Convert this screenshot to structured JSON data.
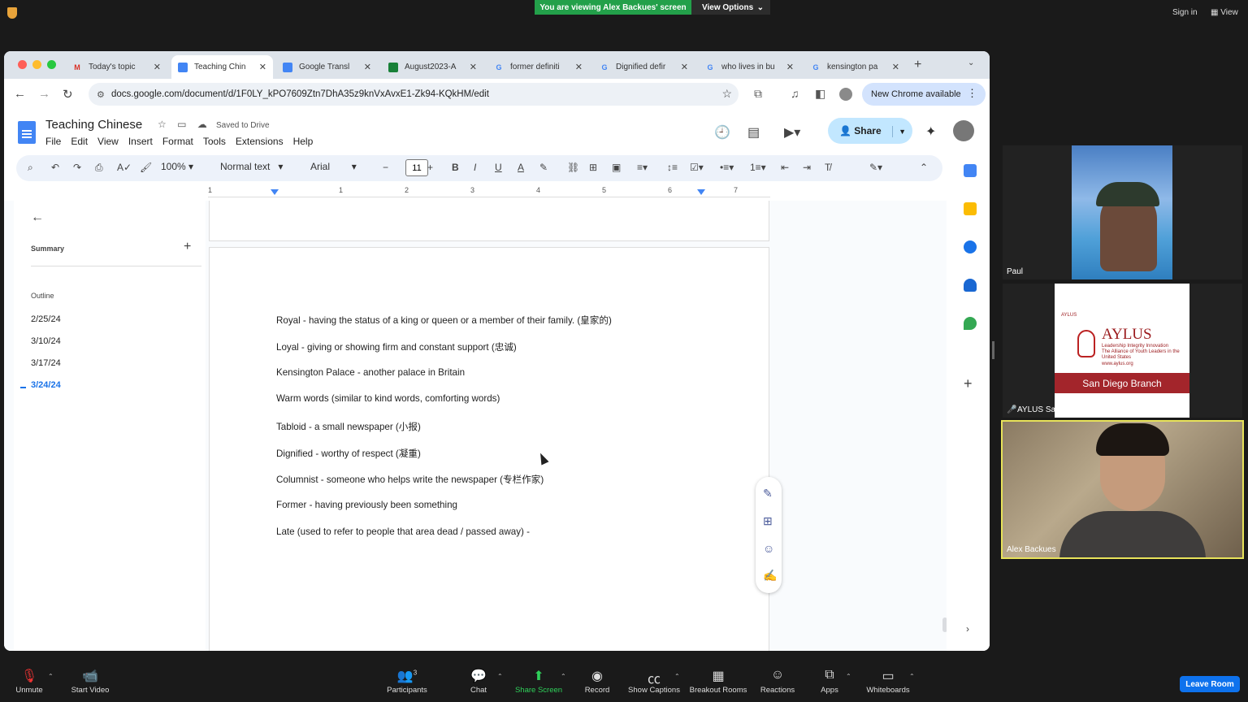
{
  "zoom": {
    "viewing_banner": "You are viewing Alex Backues' screen",
    "view_options": "View Options",
    "sign_in": "Sign in",
    "view": "View",
    "leave": "Leave Room",
    "participants_count": "3",
    "bottom": {
      "unmute": "Unmute",
      "start_video": "Start Video",
      "participants": "Participants",
      "chat": "Chat",
      "share_screen": "Share Screen",
      "record": "Record",
      "show_captions": "Show Captions",
      "breakout_rooms": "Breakout Rooms",
      "reactions": "Reactions",
      "apps": "Apps",
      "whiteboards": "Whiteboards"
    },
    "participants": [
      {
        "name": "Paul"
      },
      {
        "name": "AYLUS San Diego"
      },
      {
        "name": "Alex Backues"
      }
    ],
    "aylus": {
      "small_logo": "AYLUS",
      "name": "AYLUS",
      "tagline": "The Alliance of Youth Leaders in the United States",
      "tagline2": "Leadership Integrity Innovation",
      "url": "www.aylus.org",
      "branch": "San Diego Branch"
    }
  },
  "browser": {
    "tabs": [
      {
        "label": "Today's topic",
        "icon": "M",
        "color": "#d93025"
      },
      {
        "label": "Teaching Chin",
        "icon": "",
        "color": "#4285f4"
      },
      {
        "label": "Google Transl",
        "icon": "",
        "color": "#4285f4"
      },
      {
        "label": "August2023-A",
        "icon": "",
        "color": "#188038"
      },
      {
        "label": "former definiti",
        "icon": "G",
        "color": "#4285f4"
      },
      {
        "label": "Dignified defir",
        "icon": "G",
        "color": "#4285f4"
      },
      {
        "label": "who lives in bu",
        "icon": "G",
        "color": "#4285f4"
      },
      {
        "label": "kensington pa",
        "icon": "G",
        "color": "#4285f4"
      }
    ],
    "url": "docs.google.com/document/d/1F0LY_kPO7609Ztn7DhA35z9knVxAvxE1-Zk94-KQkHM/edit",
    "new_chrome": "New Chrome available"
  },
  "docs": {
    "title": "Teaching Chinese",
    "saved": "Saved to Drive",
    "menu": [
      "File",
      "Edit",
      "View",
      "Insert",
      "Format",
      "Tools",
      "Extensions",
      "Help"
    ],
    "share": "Share",
    "zoom": "100%",
    "style": "Normal text",
    "font": "Arial",
    "font_size": "11",
    "ruler_ticks": [
      "1",
      "1",
      "2",
      "3",
      "4",
      "5",
      "6",
      "7"
    ],
    "sidebar": {
      "summary": "Summary",
      "outline": "Outline",
      "items": [
        "2/25/24",
        "3/10/24",
        "3/17/24",
        "3/24/24"
      ]
    },
    "lines": [
      "Royal - having the status of a king or queen or a member of their family. (皇家的)",
      "Loyal - giving or showing firm and constant support (忠诚)",
      "Kensington Palace - another palace in Britain",
      "Warm words (similar to kind words, comforting words)",
      "Tabloid - a small newspaper (小报)",
      "Dignified - worthy of respect (凝重)",
      "Columnist - someone who helps write the newspaper (专栏作家)",
      "Former - having previously been something",
      "Late (used to refer to people that area dead / passed away) -"
    ]
  }
}
